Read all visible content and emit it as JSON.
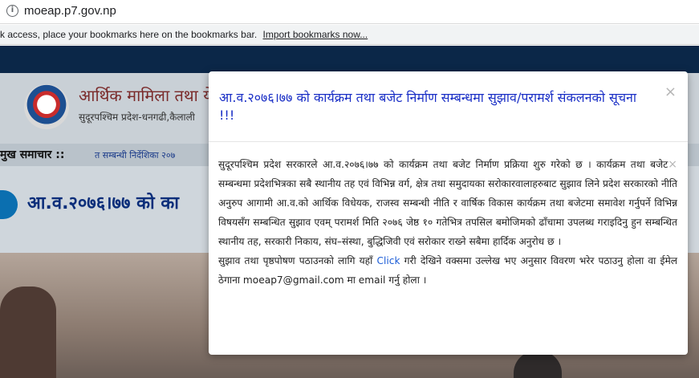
{
  "browser": {
    "url": "moeap.p7.gov.np",
    "bookmarks_message": "k access, place your bookmarks here on the bookmarks bar.",
    "bookmarks_link": "Import bookmarks now..."
  },
  "site": {
    "title": "आर्थिक मामिला तथा ये",
    "subtitle": "सुदूरपश्चिम प्रदेश-धनगढी,कैलाली",
    "news_label": "मुख समाचार ::",
    "news_ticker": "त सम्बन्धी निर्देशिका २०७",
    "page_heading": "आ.व.२०७६।७७ को का"
  },
  "modal": {
    "title": "आ.व.२०७६।७७ को कार्यक्रम तथा बजेट निर्माण सम्बन्धमा सुझाव/परामर्श संकलनको सूचना !!!",
    "close_symbol": "×",
    "body_paragraph_1": "सुदूरपश्चिम प्रदेश सरकारले आ.व.२०७६।७७ को कार्यक्रम तथा बजेट निर्माण प्रक्रिया शुरु गरेको छ । कार्यक्रम तथा बजेट सम्बन्धमा प्रदेशभित्रका सबै स्थानीय तह एवं विभिन्न वर्ग, क्षेत्र तथा समुदायका सरोकारवालाहरुबाट सुझाव लिने प्रदेश सरकारको नीति अनुरुप आगामी आ.व.को आर्थिक विधेयक, राजस्व सम्बन्धी नीति र वार्षिक विकास कार्यक्रम तथा बजेटमा समावेश गर्नुपर्ने विभिन्न विषयसँग सम्बन्धित सुझाव एवम् परामर्श मिति २०७६ जेष्ठ १० गतेभित्र तपसिल बमोजिमको ढाँचामा उपलब्ध गराइदिनु हुन सम्बन्धित स्थानीय तह, सरकारी निकाय, संघ–संस्था, बुद्धिजिवी एवं सरोकार राख्ने सबैमा हार्दिक अनुरोध छ ।",
    "body_paragraph_2_before_link": "सुझाव तथा पृष्ठपोषण पठाउनको लागि यहाँ",
    "click_link": "Click",
    "body_paragraph_2_after_link": "गरी देखिने वक्समा उल्लेख भए अनुसार विवरण भरेर पठाउनु होला वा ईमेल ठेगाना moeap7@gmail.com मा email गर्नु होला ।"
  },
  "colors": {
    "modal_title": "#1a2fc6",
    "link": "#1a5bd6",
    "nav_bar": "#0b2748"
  }
}
